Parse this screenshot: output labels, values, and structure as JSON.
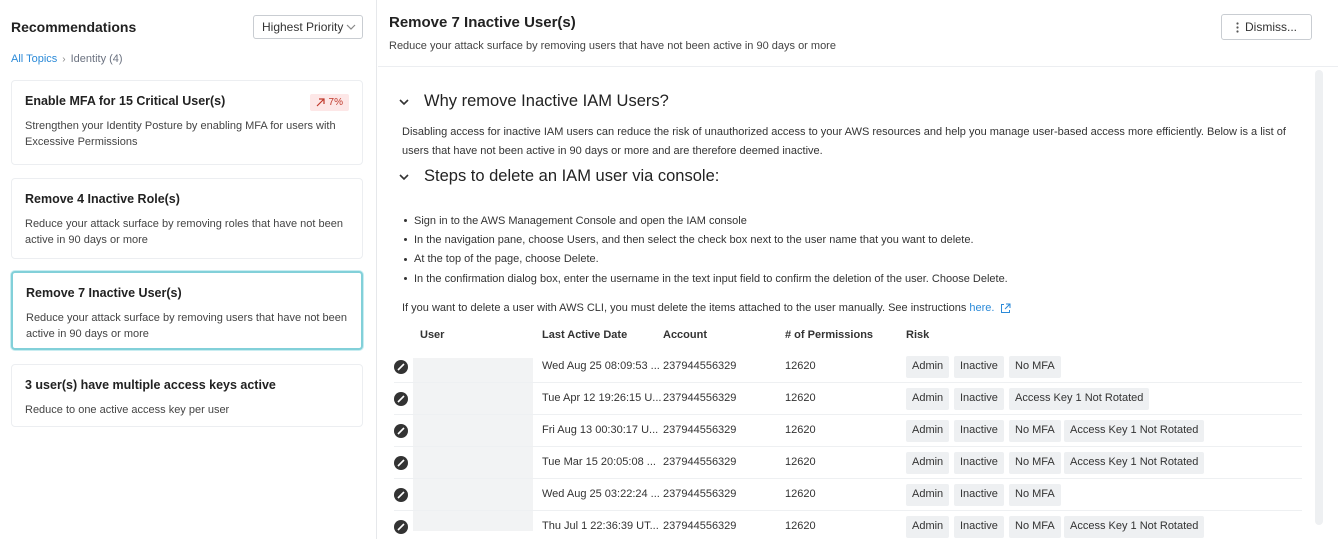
{
  "sidebar": {
    "header": "Recommendations",
    "priority_select": "Highest Priority",
    "breadcrumb": {
      "root": "All Topics",
      "current": "Identity (4)"
    },
    "cards": [
      {
        "title": "Enable MFA for 15 Critical User(s)",
        "desc": "Strengthen your Identity Posture by enabling MFA for users with Excessive Permissions",
        "badge": "7%"
      },
      {
        "title": "Remove 4 Inactive Role(s)",
        "desc": "Reduce your attack surface by removing roles that have not been active in 90 days or more"
      },
      {
        "title": "Remove 7 Inactive User(s)",
        "desc": "Reduce your attack surface by removing users that have not been active in 90 days or more"
      },
      {
        "title": "3 user(s) have multiple access keys active",
        "desc": "Reduce to one active access key per user"
      }
    ]
  },
  "main": {
    "title": "Remove 7 Inactive User(s)",
    "subtitle": "Reduce your attack surface by removing users that have not been active in 90 days or more",
    "dismiss_label": "Dismiss...",
    "why_heading": "Why remove Inactive IAM Users?",
    "why_text": "Disabling access for inactive IAM users can reduce the risk of unauthorized access to your AWS resources and help you manage user-based access more efficiently. Below is a list of users that have not been active in 90 days or more and are therefore deemed inactive.",
    "steps_heading": "Steps to delete an IAM user via console:",
    "steps": [
      "Sign in to the AWS Management Console and open the IAM console",
      "In the navigation pane, choose Users, and then select the check box next to the user name that you want to delete.",
      "At the top of the page, choose Delete.",
      "In the confirmation dialog box, enter the username in the text input field to confirm the deletion of the user. Choose Delete."
    ],
    "cli_text": "If you want to delete a user with AWS CLI, you must delete the items attached to the user manually. See instructions",
    "cli_link": "here.",
    "table": {
      "columns": [
        "User",
        "Last Active Date",
        "Account",
        "# of Permissions",
        "Risk"
      ],
      "rows": [
        {
          "date": "Wed Aug 25 08:09:53 ...",
          "account": "237944556329",
          "perms": "12620",
          "risks": [
            "Admin",
            "Inactive",
            "No MFA"
          ]
        },
        {
          "date": "Tue Apr 12 19:26:15 U...",
          "account": "237944556329",
          "perms": "12620",
          "risks": [
            "Admin",
            "Inactive",
            "Access Key 1 Not Rotated"
          ]
        },
        {
          "date": "Fri Aug 13 00:30:17 U...",
          "account": "237944556329",
          "perms": "12620",
          "risks": [
            "Admin",
            "Inactive",
            "No MFA",
            "Access Key 1 Not Rotated"
          ]
        },
        {
          "date": "Tue Mar 15 20:05:08 ...",
          "account": "237944556329",
          "perms": "12620",
          "risks": [
            "Admin",
            "Inactive",
            "No MFA",
            "Access Key 1 Not Rotated"
          ]
        },
        {
          "date": "Wed Aug 25 03:22:24 ...",
          "account": "237944556329",
          "perms": "12620",
          "risks": [
            "Admin",
            "Inactive",
            "No MFA"
          ]
        },
        {
          "date": "Thu Jul 1 22:36:39 UT...",
          "account": "237944556329",
          "perms": "12620",
          "risks": [
            "Admin",
            "Inactive",
            "No MFA",
            "Access Key 1 Not Rotated"
          ]
        }
      ]
    }
  },
  "icons": {
    "chevron": "chevron-down-icon",
    "trend": "trend-up-icon",
    "delete": "delete-circle-icon",
    "external": "external-link-icon",
    "kebab": "kebab-icon"
  },
  "colors": {
    "accent": "#2b8ad8",
    "selected_border": "#82d0d9",
    "badge_bg": "#fde7e7",
    "badge_text": "#c0392b",
    "tag_bg": "#eef0f2"
  }
}
